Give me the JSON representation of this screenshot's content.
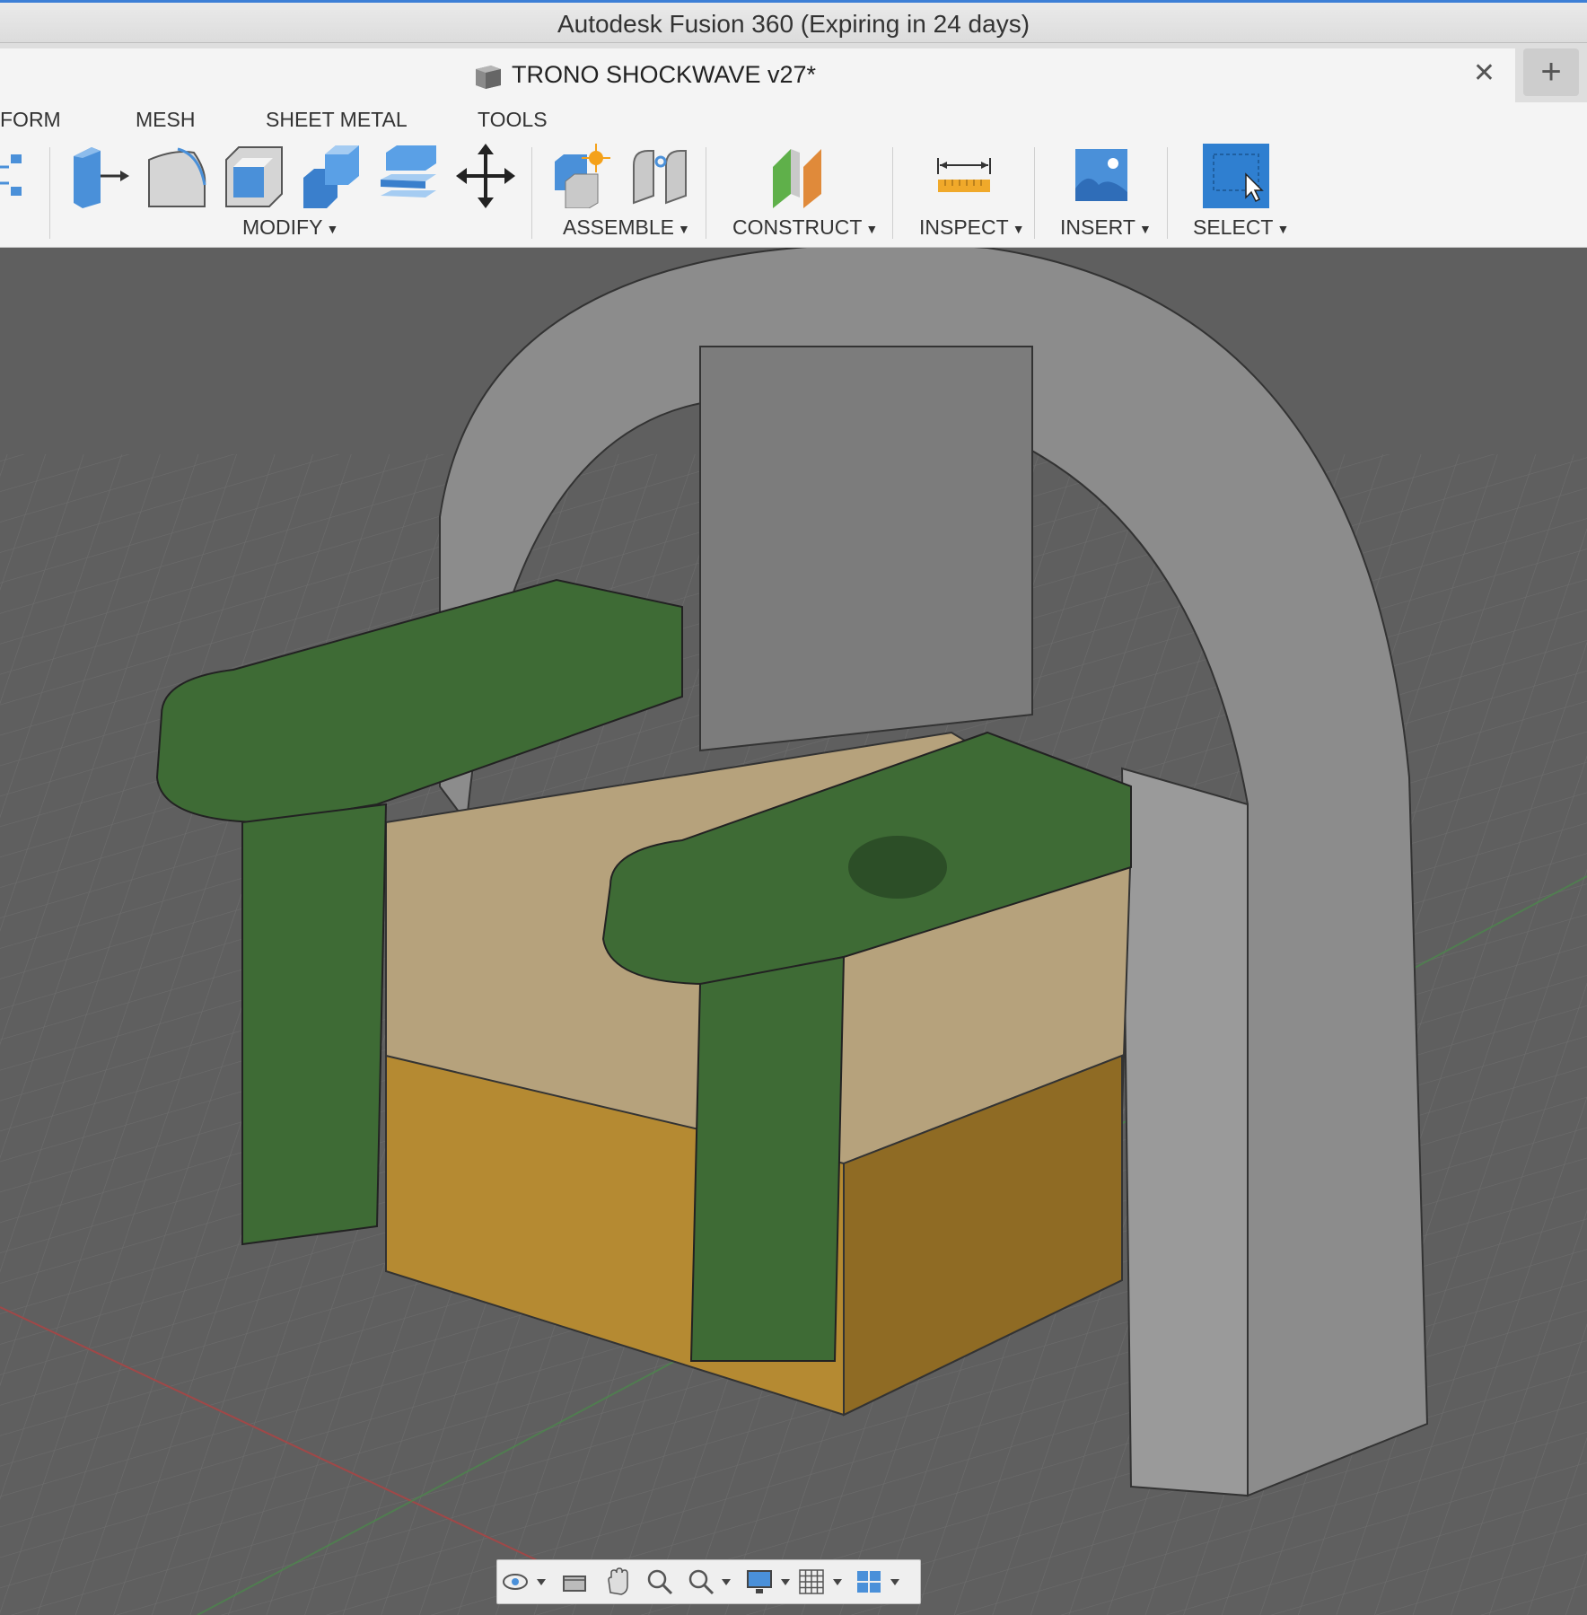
{
  "window": {
    "title": "Autodesk Fusion 360 (Expiring in 24 days)"
  },
  "document_tab": {
    "title": "TRONO SHOCKWAVE v27*",
    "close_glyph": "✕",
    "new_tab_glyph": "+"
  },
  "workspace_tabs": [
    "FORM",
    "MESH",
    "SHEET METAL",
    "TOOLS"
  ],
  "toolbar_groups": {
    "modify": "MODIFY",
    "assemble": "ASSEMBLE",
    "construct": "CONSTRUCT",
    "inspect": "INSPECT",
    "insert": "INSERT",
    "select": "SELECT"
  },
  "icons": {
    "modify": [
      "press-pull-icon",
      "fillet-icon",
      "shell-icon",
      "combine-icon",
      "offset-face-icon",
      "move-icon"
    ],
    "assemble": [
      "new-component-icon",
      "joint-icon"
    ],
    "construct": [
      "offset-plane-icon"
    ],
    "inspect": [
      "measure-icon"
    ],
    "insert": [
      "insert-image-icon"
    ],
    "select": [
      "window-select-icon"
    ],
    "navbar": [
      "orbit-icon",
      "look-at-icon",
      "pan-icon",
      "zoom-icon",
      "fit-icon",
      "display-settings-icon",
      "grid-settings-icon",
      "viewports-icon"
    ]
  },
  "colors": {
    "accent": "#3d7fd6",
    "body_green": "#3e6b35",
    "body_tan": "#b6a27c",
    "body_gold": "#b58a32",
    "body_gray": "#8a8a8a",
    "canvas_bg": "#5f5f5f"
  }
}
